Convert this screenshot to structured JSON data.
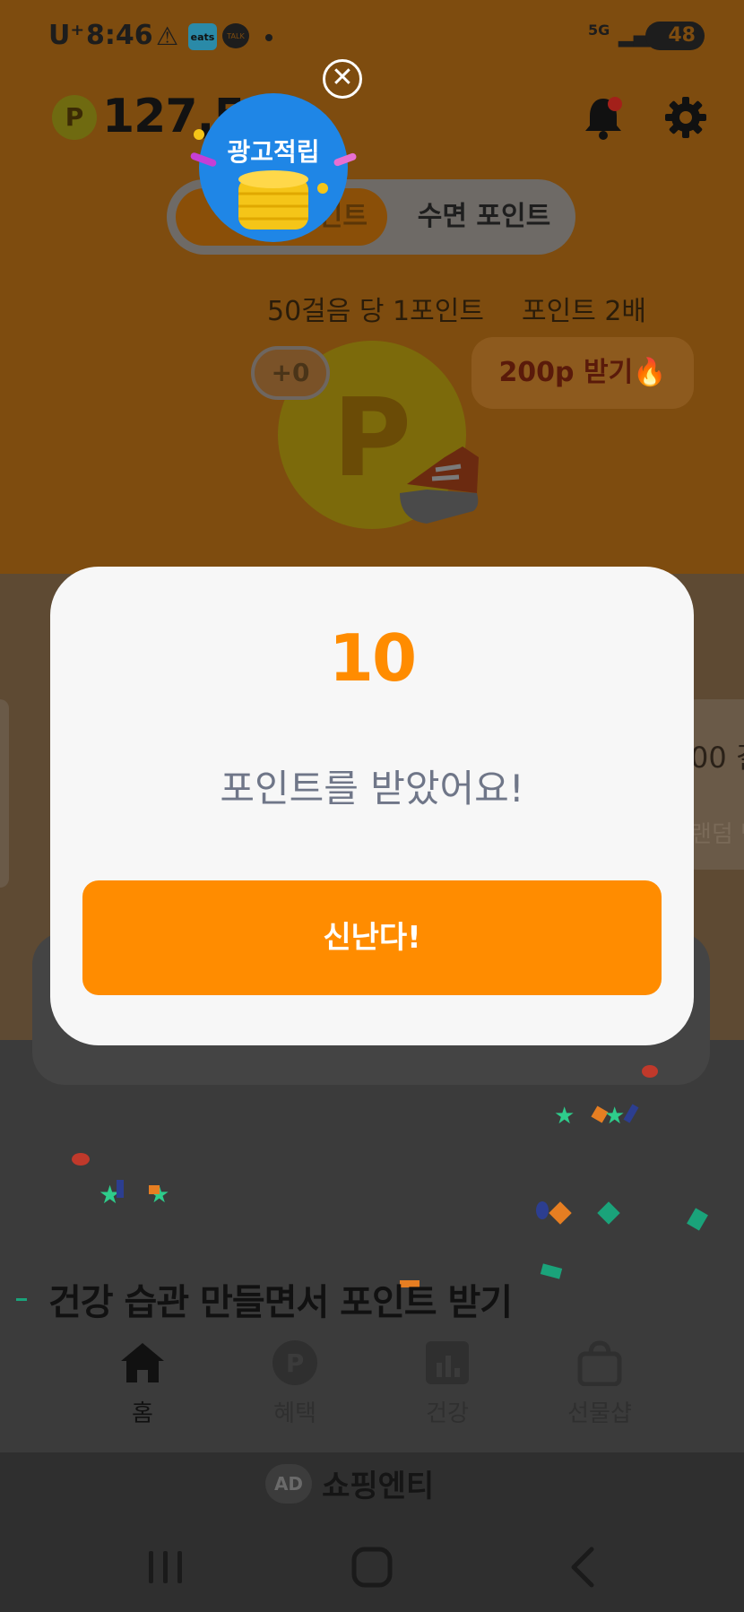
{
  "status_bar": {
    "carrier": "U⁺",
    "time": "8:46",
    "eats_label": "eats",
    "talk_label": "TALK",
    "network": "5G",
    "battery": "48"
  },
  "header": {
    "points": "127,5",
    "point_symbol": "P"
  },
  "tabs": {
    "active_label": "인트",
    "sleep_label": "수면 포인트"
  },
  "ad_bubble": {
    "title": "광고적립",
    "close_symbol": "✕"
  },
  "step_info": {
    "per_steps": "50걸음 당 1포인트",
    "double": "포인트 2배"
  },
  "plus_badge": "+0",
  "reward_button": "200p 받기🔥",
  "coin_symbol": "P",
  "modal": {
    "amount": "10",
    "message": "포인트를 받았어요!",
    "confirm_label": "신난다!"
  },
  "side_text_right": "00 걸",
  "side_text_right2": "랜덤 받",
  "section": {
    "heading": "건강 습관 만들면서 포인트 받기"
  },
  "bottom_nav": {
    "items": [
      {
        "label": "홈",
        "icon": "home-icon"
      },
      {
        "label": "혜택",
        "icon": "point-icon"
      },
      {
        "label": "건강",
        "icon": "chart-icon"
      },
      {
        "label": "선물샵",
        "icon": "bag-icon"
      }
    ]
  },
  "ad_banner": {
    "tag": "AD",
    "text": "쇼핑엔티"
  },
  "colors": {
    "accent": "#ff8c00",
    "modal_bg": "#f7f7f7",
    "message": "#6f7688"
  }
}
